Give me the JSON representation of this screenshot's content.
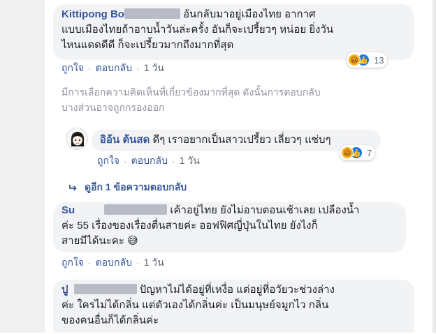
{
  "comments": [
    {
      "name": "Kittipong Bo",
      "text_line1": "อันกลับมาอยู่เมืองไทย อากาศ",
      "text_line2": "แบบเมืองไทยถ้าอาบน้ำวันล่ะครั้ง อันก็จะเปรี้ยวๆ หน่อย ยิ่งวัน",
      "text_line3": "ไหนแดดดีดี ก็จะเปรี้ยวมากถึงมากที่สุด",
      "reaction_count": "13",
      "like_label": "ถูกใจ",
      "reply_label": "ตอบกลับ",
      "time": "1 วัน"
    },
    {
      "name": "Su",
      "text_line1": "เค้าอยู่ไทย ยังไม่อาบตอนเช้าเลย เปลืองน้ำ",
      "text_line2": "ค่ะ 55 เรื่องของเรื่องตื่นสายค่ะ ออฟฟิศญี่ปุ่นในไทย ยังไงก็",
      "text_line3": "สายมีได้นะคะ 😅",
      "like_label": "ถูกใจ",
      "reply_label": "ตอบกลับ",
      "time": "1 วัน"
    },
    {
      "name": "ปู",
      "text_line1": "ปัญหาไม่ได้อยู่ที่เหงื่อ แต่อยู่ที่อวัยวะช่วงล่าง",
      "text_line2": "ค่ะ ใครไม่ได้กลิ่น แต่ตัวเองได้กลิ่นค่ะ เป็นมนุษย์จมูกไว กลิ่น",
      "text_line3": "ของคนอื่นก็ได้กลิ่นค่ะ"
    }
  ],
  "notice": {
    "line1": "มีการเลือกความคิดเห็นที่เกี่ยวข้องมากที่สุด ดังนั้นการตอบกลับ",
    "line2": "บางส่วนอาจถูกกรองออก"
  },
  "reply": {
    "name": "อิอ้น ต้นสด",
    "text": "ดีๆ เราอยากเป็นสาวเปรี้ยว เลี่ยวๆ แซ่บๆ",
    "reaction_count": "7",
    "like_label": "ถูกใจ",
    "reply_label": "ตอบกลับ",
    "time": "1 วัน"
  },
  "more_replies": {
    "label": "ดูอีก 1 ข้อความตอบกลับ"
  },
  "separator": "·"
}
